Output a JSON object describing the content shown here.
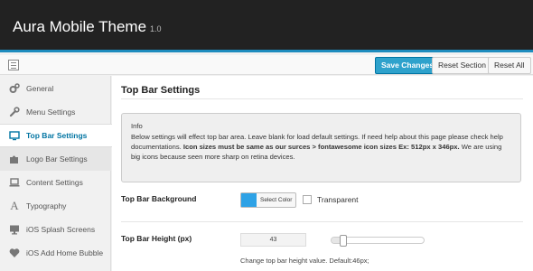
{
  "header": {
    "title": "Aura Mobile Theme",
    "version": "1.0"
  },
  "toolbar": {
    "save_label": "Save Changes",
    "reset_section_label": "Reset Section",
    "reset_all_label": "Reset All"
  },
  "sidebar": {
    "items": [
      {
        "label": "General",
        "icon": "gears-icon"
      },
      {
        "label": "Menu Settings",
        "icon": "wrench-icon"
      },
      {
        "label": "Top Bar Settings",
        "icon": "monitor-icon",
        "active": true
      },
      {
        "label": "Logo Bar Settings",
        "icon": "puzzle-icon"
      },
      {
        "label": "Content Settings",
        "icon": "laptop-icon"
      },
      {
        "label": "Typography",
        "icon": "font-icon"
      },
      {
        "label": "iOS Splash Screens",
        "icon": "desktop-icon"
      },
      {
        "label": "iOS Add Home Bubble",
        "icon": "heart-icon"
      }
    ]
  },
  "main": {
    "title": "Top Bar Settings",
    "info": {
      "heading": "Info",
      "line1": "Below settings will effect top bar area. Leave blank for load default settings. If need help about this page please check help documentations.",
      "bold": "Icon sizes must be same as our surces > fontawesome icon sizes Ex: 512px x 346px.",
      "line2": "We are using big icons because seen more sharp on retina devices."
    },
    "background": {
      "label": "Top Bar Background",
      "select_color_label": "Select Color",
      "swatch_color": "#2ea2e6",
      "transparent_label": "Transparent",
      "transparent_checked": false
    },
    "height": {
      "label": "Top Bar Height (px)",
      "value": "43",
      "slider_fraction": 0.05,
      "help": "Change top bar height value. Default:46px;"
    }
  },
  "colors": {
    "header_bg": "#222222",
    "accent": "#2ea2cc",
    "active_text": "#0074a2"
  }
}
